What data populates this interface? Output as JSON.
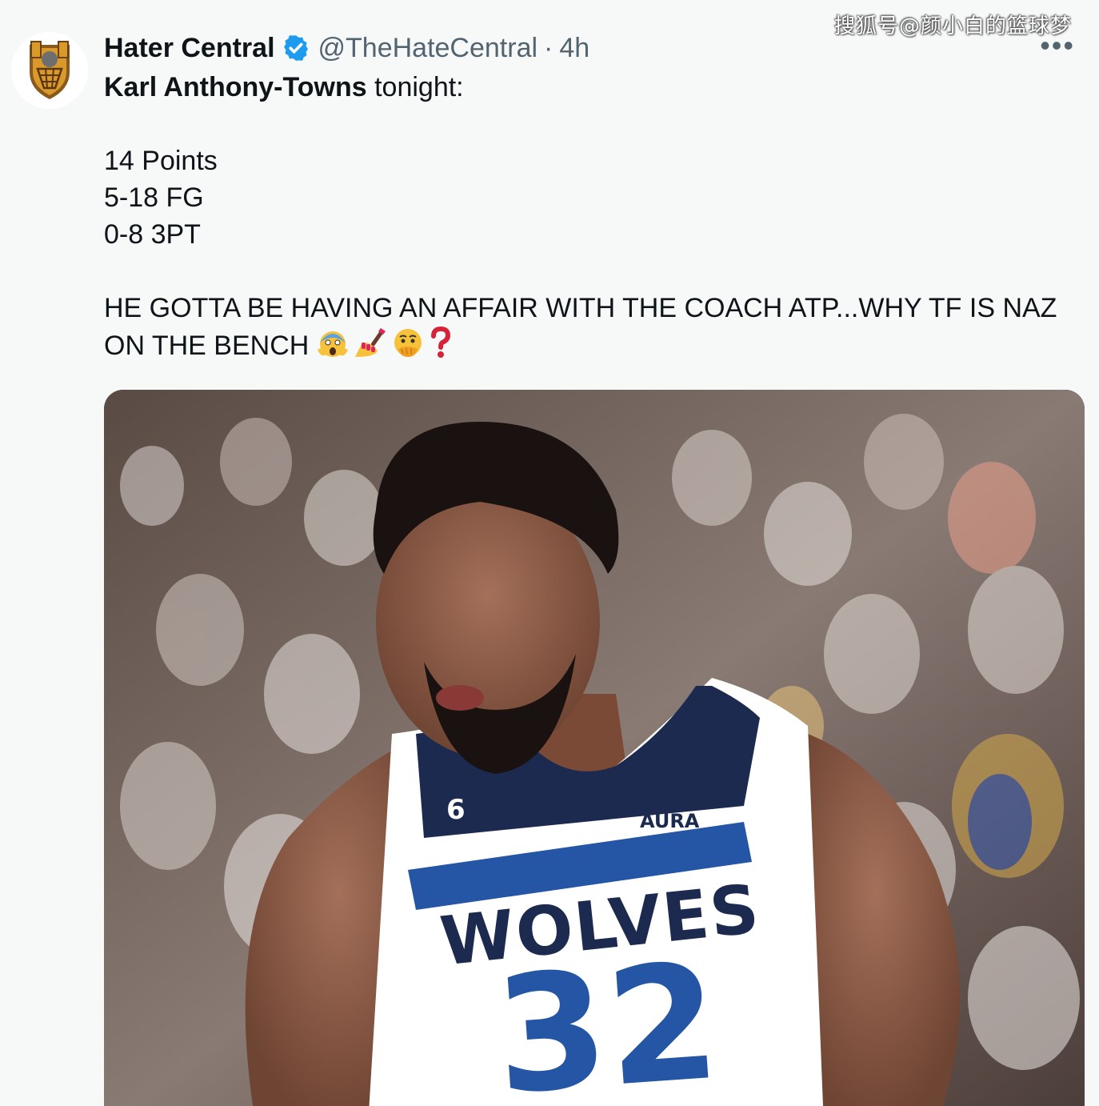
{
  "watermark": "搜狐号@颜小白的篮球梦",
  "tweet": {
    "display_name": "Hater Central",
    "handle": "@TheHateCentral",
    "separator": "·",
    "time": "4h",
    "more_label": "•••",
    "text": {
      "mention": "Karl Anthony-Towns",
      "intro_rest": " tonight:",
      "stats": [
        "14 Points",
        "5-18 FG",
        "0-8 3PT"
      ],
      "line1": "HE GOTTA BE HAVING AN AFFAIR WITH THE COACH ATP...WHY TF IS NAZ",
      "line2": "ON THE BENCH "
    },
    "emojis": [
      "face-screaming-in-fear",
      "nail-polish",
      "face-with-hand-over-mouth",
      "red-question-mark"
    ],
    "media": {
      "jersey_team": "WOLVES",
      "jersey_number": "32",
      "jersey_sponsor": "ĀURA",
      "patch_number": "6"
    }
  },
  "colors": {
    "verified": "#1d9bf0",
    "text_primary": "#0f1419",
    "text_secondary": "#536471",
    "background": "#f7f9f9",
    "jersey_navy": "#1b2a4e",
    "jersey_blue": "#2456a5"
  }
}
